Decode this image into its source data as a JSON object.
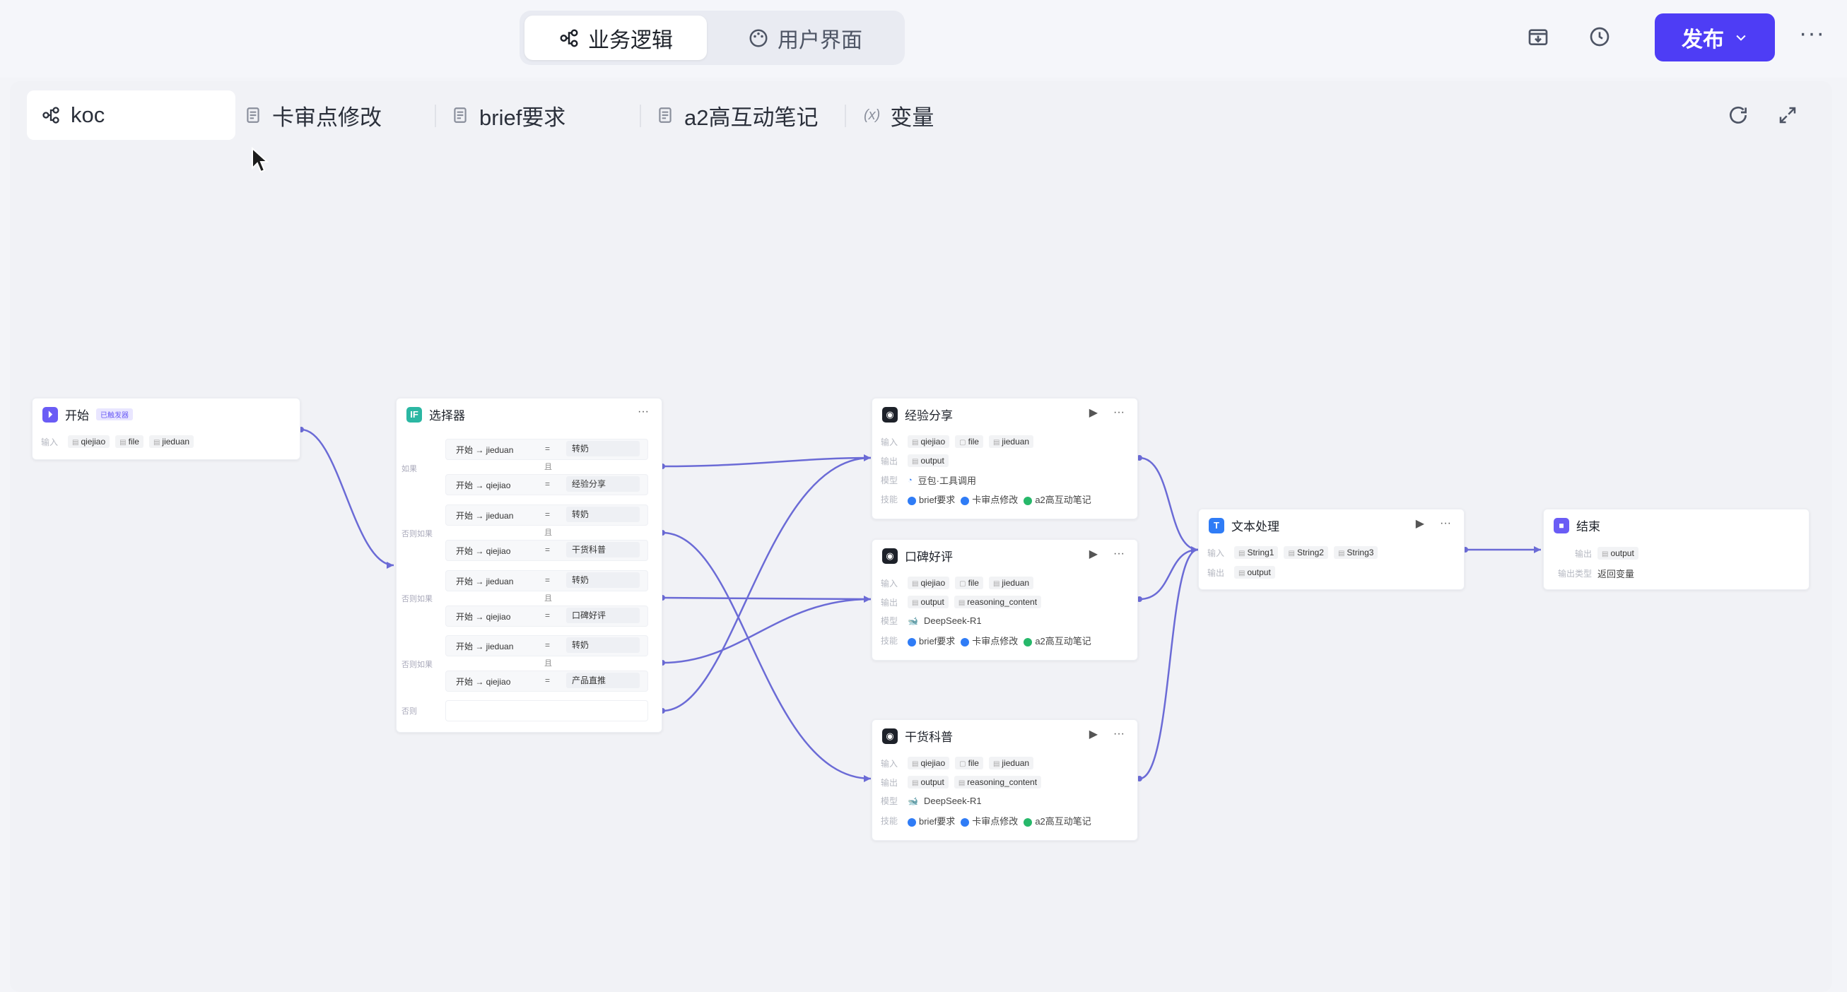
{
  "header": {
    "mode_tabs": [
      {
        "label": "业务逻辑",
        "icon": "workflow-icon",
        "active": true
      },
      {
        "label": "用户界面",
        "icon": "palette-icon",
        "active": false
      }
    ],
    "publish_label": "发布",
    "more": "···"
  },
  "file_tabs": [
    {
      "label": "koc",
      "icon": "workflow-icon",
      "active": true
    },
    {
      "label": "卡审点修改",
      "icon": "document-icon"
    },
    {
      "label": "brief要求",
      "icon": "document-icon"
    },
    {
      "label": "a2高互动笔记",
      "icon": "document-icon"
    },
    {
      "label": "变量",
      "icon": "variable-icon"
    }
  ],
  "nodes": {
    "start": {
      "title": "开始",
      "badge": "已触发器",
      "input_label": "输入",
      "inputs": [
        "qiejiao",
        "file",
        "jieduan"
      ]
    },
    "selector": {
      "title": "选择器",
      "more": "···",
      "branches": [
        {
          "side": "如果",
          "conds": [
            {
              "left": "开始 → jieduan",
              "op": "=",
              "value": "转奶"
            },
            {
              "left": "开始 → qiejiao",
              "op": "=",
              "value": "经验分享"
            }
          ]
        },
        {
          "side": "否则如果",
          "conds": [
            {
              "left": "开始 → jieduan",
              "op": "=",
              "value": "转奶"
            },
            {
              "left": "开始 → qiejiao",
              "op": "=",
              "value": "干货科普"
            }
          ]
        },
        {
          "side": "否则如果",
          "conds": [
            {
              "left": "开始 → jieduan",
              "op": "=",
              "value": "转奶"
            },
            {
              "left": "开始 → qiejiao",
              "op": "=",
              "value": "口碑好评"
            }
          ]
        },
        {
          "side": "否则如果",
          "conds": [
            {
              "left": "开始 → jieduan",
              "op": "=",
              "value": "转奶"
            },
            {
              "left": "开始 → qiejiao",
              "op": "=",
              "value": "产品直推"
            }
          ]
        }
      ],
      "and_label": "且",
      "else_label": "否则"
    },
    "llm_nodes": [
      {
        "title": "经验分享",
        "input_label": "输入",
        "inputs": [
          "qiejiao",
          "file",
          "jieduan"
        ],
        "output_label": "输出",
        "outputs": [
          "output"
        ],
        "model_label": "模型",
        "model": "豆包·工具调用",
        "skill_label": "技能",
        "skills": [
          "brief要求",
          "卡审点修改",
          "a2高互动笔记"
        ]
      },
      {
        "title": "口碑好评",
        "input_label": "输入",
        "inputs": [
          "qiejiao",
          "file",
          "jieduan"
        ],
        "output_label": "输出",
        "outputs": [
          "output",
          "reasoning_content"
        ],
        "model_label": "模型",
        "model": "DeepSeek-R1",
        "skill_label": "技能",
        "skills": [
          "brief要求",
          "卡审点修改",
          "a2高互动笔记"
        ]
      },
      {
        "title": "干货科普",
        "input_label": "输入",
        "inputs": [
          "qiejiao",
          "file",
          "jieduan"
        ],
        "output_label": "输出",
        "outputs": [
          "output",
          "reasoning_content"
        ],
        "model_label": "模型",
        "model": "DeepSeek-R1",
        "skill_label": "技能",
        "skills": [
          "brief要求",
          "卡审点修改",
          "a2高互动笔记"
        ]
      }
    ],
    "text_proc": {
      "title": "文本处理",
      "input_label": "输入",
      "inputs": [
        "String1",
        "String2",
        "String3"
      ],
      "output_label": "输出",
      "outputs": [
        "output"
      ]
    },
    "end": {
      "title": "结束",
      "output_label": "输出",
      "output": "output",
      "type_label": "输出类型",
      "type_value": "返回变量"
    }
  },
  "colors": {
    "accent": "#4e3df5",
    "edge": "#6b6bd6",
    "skill_blue": "#2f7cf6",
    "skill_green": "#27b86a"
  }
}
